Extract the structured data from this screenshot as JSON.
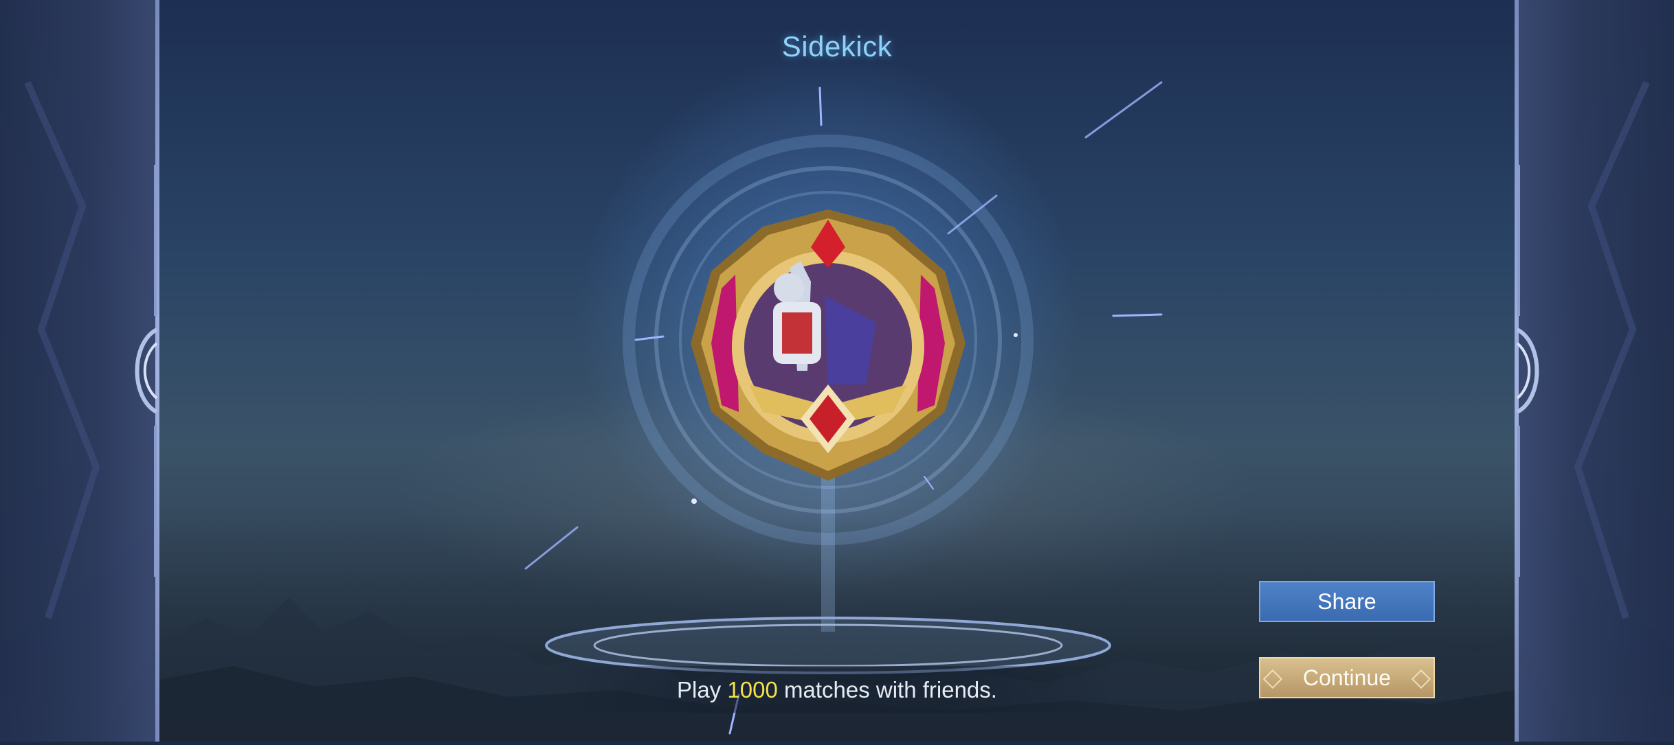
{
  "achievement": {
    "title": "Sidekick",
    "description_prefix": "Play ",
    "description_highlight": "1000",
    "description_suffix": " matches with friends.",
    "emblem_icon": "knight-medal-icon"
  },
  "buttons": {
    "share_label": "Share",
    "continue_label": "Continue"
  },
  "colors": {
    "title": "#8fd2f5",
    "highlight": "#f3e04c",
    "share_button": "#3a6bb1",
    "continue_button": "#c4a874"
  }
}
